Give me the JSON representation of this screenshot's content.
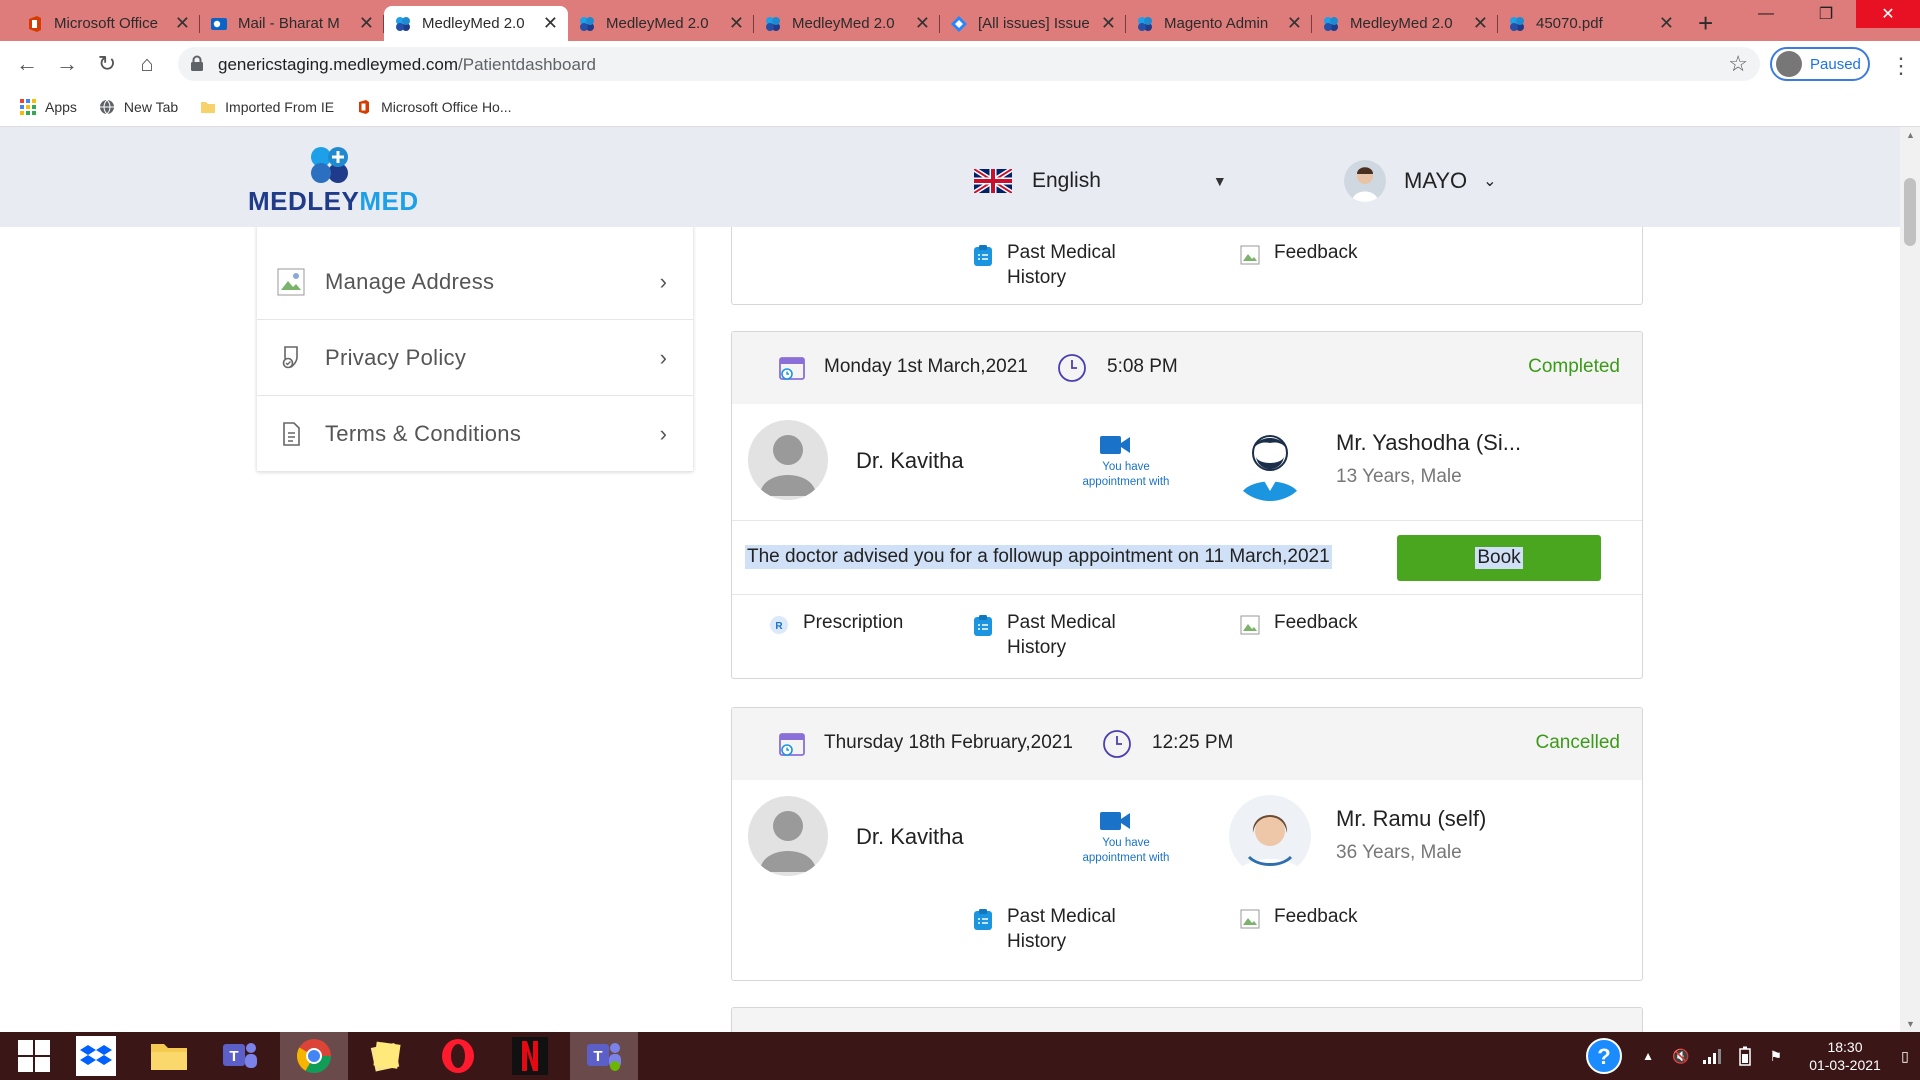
{
  "browser": {
    "tabs": [
      {
        "title": "Microsoft Office",
        "icon": "office-icon",
        "active": false
      },
      {
        "title": "Mail - Bharat M",
        "icon": "outlook-icon",
        "active": false
      },
      {
        "title": "MedleyMed 2.0",
        "icon": "medleymed-icon",
        "active": true
      },
      {
        "title": "MedleyMed 2.0",
        "icon": "medleymed-icon",
        "active": false
      },
      {
        "title": "MedleyMed 2.0",
        "icon": "medleymed-icon",
        "active": false
      },
      {
        "title": "[All issues] Issue",
        "icon": "jira-icon",
        "active": false
      },
      {
        "title": "Magento Admin",
        "icon": "medleymed-icon",
        "active": false
      },
      {
        "title": "MedleyMed 2.0",
        "icon": "medleymed-icon",
        "active": false
      },
      {
        "title": "45070.pdf",
        "icon": "pdf-icon",
        "active": false
      }
    ],
    "new_tab": "+",
    "url_host": "genericstaging.medleymed.com",
    "url_path": "/Patientdashboard",
    "profile_label": "Paused",
    "bookmarks": [
      {
        "label": "Apps",
        "icon": "apps-grid-icon"
      },
      {
        "label": "New Tab",
        "icon": "globe-icon"
      },
      {
        "label": "Imported From IE",
        "icon": "folder-icon"
      },
      {
        "label": "Microsoft Office Ho...",
        "icon": "office-icon"
      }
    ]
  },
  "header": {
    "logo_text_a": "MEDLEY",
    "logo_text_b": "MED",
    "language": "English",
    "user_name": "MAYO"
  },
  "sidebar": {
    "items": [
      {
        "label": "Manage Address",
        "icon": "image-placeholder-icon"
      },
      {
        "label": "Privacy Policy",
        "icon": "shield-icon"
      },
      {
        "label": "Terms & Conditions",
        "icon": "document-icon"
      }
    ]
  },
  "cards": {
    "top": {
      "past_history": [
        "Past Medical",
        "History"
      ],
      "feedback": "Feedback"
    },
    "first": {
      "date": "Monday 1st March,2021",
      "time": "5:08 PM",
      "status": "Completed",
      "doctor": "Dr. Kavitha",
      "appointment_note": [
        "You have",
        "appointment with"
      ],
      "patient": "Mr. Yashodha (Si...",
      "patient_meta": "13 Years, Male",
      "followup": "The doctor advised you for a followup appointment on 11 March,2021",
      "book": "Book",
      "prescription": "Prescription",
      "past_history": [
        "Past Medical",
        "History"
      ],
      "feedback": "Feedback"
    },
    "second": {
      "date": "Thursday 18th February,2021",
      "time": "12:25 PM",
      "status": "Cancelled",
      "doctor": "Dr. Kavitha",
      "appointment_note": [
        "You have",
        "appointment with"
      ],
      "patient": "Mr. Ramu (self)",
      "patient_meta": "36 Years, Male",
      "past_history": [
        "Past Medical",
        "History"
      ],
      "feedback": "Feedback"
    }
  },
  "taskbar": {
    "time": "18:30",
    "date": "01-03-2021"
  },
  "colors": {
    "tab_strip": "#de7b7b",
    "status_green": "#3c9a1a",
    "book_green": "#4aa61e",
    "brand_navy": "#1f3b8a",
    "brand_blue": "#1da0e8"
  }
}
